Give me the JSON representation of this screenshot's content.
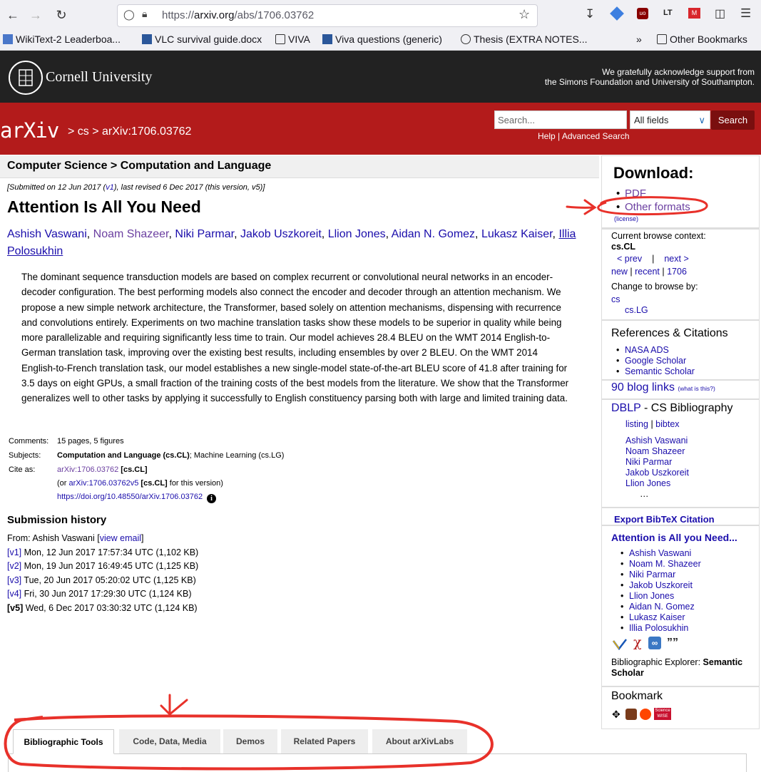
{
  "browser": {
    "url_prefix": "https://",
    "url_host": "arxiv.org",
    "url_path": "/abs/1706.03762",
    "bookmarks": [
      {
        "label": "WikiText-2 Leaderboa..."
      },
      {
        "label": "VLC survival guide.docx"
      },
      {
        "label": "VIVA"
      },
      {
        "label": "Viva questions (generic)"
      },
      {
        "label": "Thesis (EXTRA NOTES..."
      }
    ],
    "other_bookmarks": "Other Bookmarks",
    "chevron": "»"
  },
  "cornell": {
    "name": "Cornell University",
    "support_line1": "We gratefully acknowledge support from",
    "support_line2": "the Simons Foundation and University of Southampton."
  },
  "arxiv_header": {
    "logo": "arXiv",
    "breadcrumb": "> cs > arXiv:1706.03762",
    "search_placeholder": "Search...",
    "field_select": "All fields",
    "search_button": "Search",
    "help": "Help",
    "advanced_search": "Advanced Search"
  },
  "paper": {
    "subject_header": "Computer Science > Computation and Language",
    "dateline_pre": "[Submitted on 12 Jun 2017 (",
    "dateline_v1": "v1",
    "dateline_post": "), last revised 6 Dec 2017 (this version, v5)]",
    "title": "Attention Is All You Need",
    "authors": [
      "Ashish Vaswani",
      "Noam Shazeer",
      "Niki Parmar",
      "Jakob Uszkoreit",
      "Llion Jones",
      "Aidan N. Gomez",
      "Lukasz Kaiser",
      "Illia Polosukhin"
    ],
    "abstract": "The dominant sequence transduction models are based on complex recurrent or convolutional neural networks in an encoder-decoder configuration. The best performing models also connect the encoder and decoder through an attention mechanism. We propose a new simple network architecture, the Transformer, based solely on attention mechanisms, dispensing with recurrence and convolutions entirely. Experiments on two machine translation tasks show these models to be superior in quality while being more parallelizable and requiring significantly less time to train. Our model achieves 28.4 BLEU on the WMT 2014 English-to-German translation task, improving over the existing best results, including ensembles by over 2 BLEU. On the WMT 2014 English-to-French translation task, our model establishes a new single-model state-of-the-art BLEU score of 41.8 after training for 3.5 days on eight GPUs, a small fraction of the training costs of the best models from the literature. We show that the Transformer generalizes well to other tasks by applying it successfully to English constituency parsing both with large and limited training data."
  },
  "metadata": {
    "comments_label": "Comments:",
    "comments": "15 pages, 5 figures",
    "subjects_label": "Subjects:",
    "subjects_main": "Computation and Language (cs.CL)",
    "subjects_rest": "; Machine Learning (cs.LG)",
    "cite_label": "Cite as:",
    "cite_id": "arXiv:1706.03762",
    "cite_cat": "[cs.CL]",
    "cite_or": "(or ",
    "cite_v5": "arXiv:1706.03762v5",
    "cite_v5_cat": "[cs.CL]",
    "cite_v5_post": " for this version)",
    "doi": "https://doi.org/10.48550/arXiv.1706.03762",
    "info_icon": "i"
  },
  "history": {
    "title": "Submission history",
    "from_pre": "From: Ashish Vaswani [",
    "view_email": "view email",
    "from_post": "]",
    "versions": [
      {
        "tag": "[v1]",
        "text": " Mon, 12 Jun 2017 17:57:34 UTC (1,102 KB)"
      },
      {
        "tag": "[v2]",
        "text": " Mon, 19 Jun 2017 16:49:45 UTC (1,125 KB)"
      },
      {
        "tag": "[v3]",
        "text": " Tue, 20 Jun 2017 05:20:02 UTC (1,125 KB)"
      },
      {
        "tag": "[v4]",
        "text": " Fri, 30 Jun 2017 17:29:30 UTC (1,124 KB)"
      },
      {
        "tag": "[v5]",
        "text": " Wed, 6 Dec 2017 03:30:32 UTC (1,124 KB)"
      }
    ]
  },
  "tabs": [
    "Bibliographic Tools",
    "Code, Data, Media",
    "Demos",
    "Related Papers",
    "About arXivLabs"
  ],
  "sidebar": {
    "download_title": "Download:",
    "pdf": "PDF",
    "other_formats": "Other formats",
    "license": "(license)",
    "browse_context_label": "Current browse context:",
    "browse_context": "cs.CL",
    "prev": "< prev",
    "divider": "|",
    "next": "next >",
    "new": "new",
    "recent": "recent",
    "month": "1706",
    "change_browse": "Change to browse by:",
    "cs": "cs",
    "cs_lg": "cs.LG",
    "refs_title": "References & Citations",
    "refs": [
      "NASA ADS",
      "Google Scholar",
      "Semantic Scholar"
    ],
    "blog_links": "90 blog links",
    "what_is_this": "(what is this?)",
    "dblp": "DBLP",
    "dblp_rest": " - CS Bibliography",
    "listing": "listing",
    "bibtex": "bibtex",
    "dblp_authors": [
      "Ashish Vaswani",
      "Noam Shazeer",
      "Niki Parmar",
      "Jakob Uszkoreit",
      "Llion Jones"
    ],
    "ellipsis": "…",
    "export_bibtex": "Export BibTeX Citation",
    "ss_title": "Attention is All you Need...",
    "ss_authors": [
      "Ashish Vaswani",
      "Noam M. Shazeer",
      "Niki Parmar",
      "Jakob Uszkoreit",
      "Llion Jones",
      "Aidan N. Gomez",
      "Lukasz Kaiser",
      "Illia Polosukhin"
    ],
    "explorer_pre": "Bibliographic Explorer: ",
    "explorer_bold": "Semantic Scholar",
    "bookmark_title": "Bookmark",
    "science_wise": "Science WISE"
  },
  "colors": {
    "arxiv_red": "#b31b1b",
    "cornell_black": "#222222",
    "link": "#1a0dab",
    "annotation": "#e8312a"
  }
}
